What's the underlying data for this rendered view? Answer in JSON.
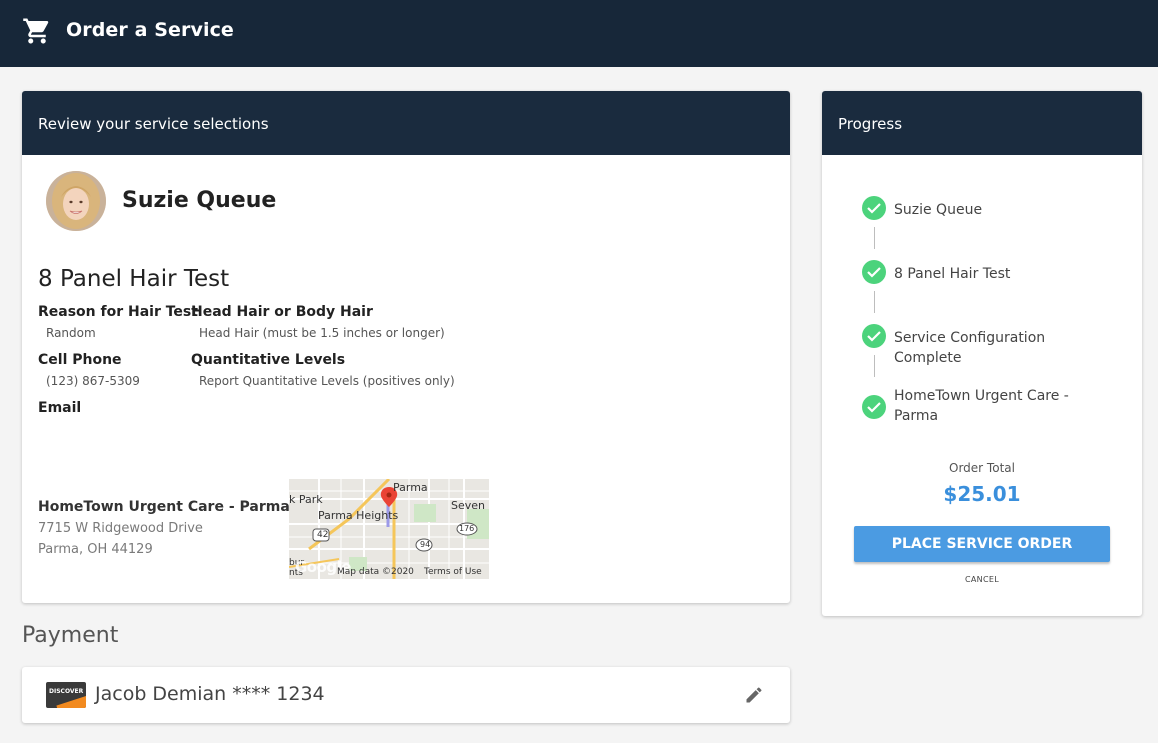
{
  "header": {
    "title": "Order a Service",
    "icon": "cart-icon"
  },
  "review": {
    "heading": "Review your service selections",
    "person_name": "Suzie Queue",
    "service_title": "8 Panel Hair Test",
    "fields": {
      "reason_label": "Reason for Hair Test",
      "reason_value": "Random",
      "hair_label": "Head Hair or Body Hair",
      "hair_value": "Head Hair (must be 1.5 inches or longer)",
      "phone_label": "Cell Phone",
      "phone_value": "(123) 867-5309",
      "levels_label": "Quantitative Levels",
      "levels_value": "Report Quantitative Levels (positives only)",
      "email_label": "Email"
    },
    "location": {
      "name": "HomeTown Urgent Care - Parma",
      "address1": "7715 W Ridgewood Drive",
      "address2": "Parma, OH 44129"
    },
    "map": {
      "label_parma": "Parma",
      "label_park": "k Park",
      "label_heights": "Parma Heights",
      "label_seven": "Seven H",
      "route_42": "42",
      "route_94": "94",
      "route_176": "176",
      "google": "Google",
      "map_data": "Map data ©2020",
      "terms": "Terms of Use",
      "edge_text_1": "bur",
      "edge_text_2": "nts"
    }
  },
  "payment": {
    "title": "Payment",
    "card_brand": "DISCOVER",
    "card_text": "Jacob Demian **** 1234"
  },
  "progress": {
    "heading": "Progress",
    "steps": [
      {
        "label": "Suzie Queue"
      },
      {
        "label": "8 Panel Hair Test"
      },
      {
        "label": "Service Configuration Complete"
      },
      {
        "label": "HomeTown Urgent Care - Parma"
      }
    ],
    "total_label": "Order Total",
    "total_value": "$25.01",
    "place_order": "PLACE SERVICE ORDER",
    "cancel": "CANCEL"
  },
  "colors": {
    "header_bg": "#172739",
    "accent": "#4b9be2",
    "total": "#3a8fdc",
    "check": "#4cd37c"
  }
}
